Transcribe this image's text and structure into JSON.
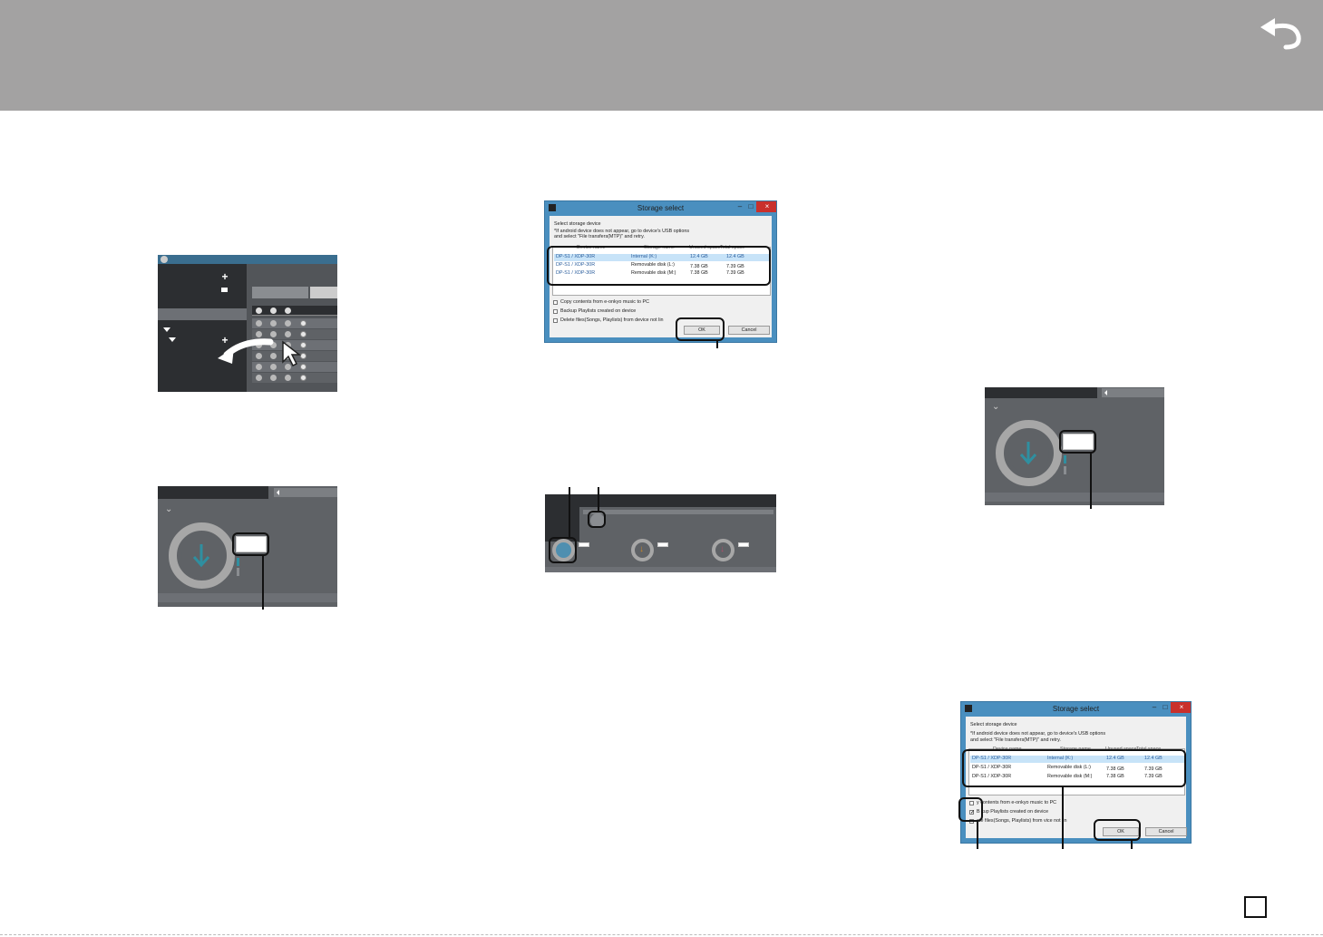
{
  "header": {
    "back_icon": "undo-arrow-icon",
    "color": "#a3a2a2"
  },
  "dialog": {
    "title": "Storage select",
    "minimize": "–",
    "maximize": "□",
    "close": "×",
    "instruction": "Select storage device",
    "note_line1": "*If android device does not appear, go to device's USB options",
    "note_line2": "and select \"File transfers(MTP)\" and retry.",
    "columns": [
      "Device name",
      "Storage name",
      "Unused space",
      "Total space"
    ],
    "rows": [
      [
        "DP-S1 / XDP-30R",
        "Internal (K:)",
        "12.4 GB",
        "12.4 GB"
      ],
      [
        "DP-S1 / XDP-30R",
        "Removable disk (L:)",
        "7.38 GB",
        "7.39 GB"
      ],
      [
        "DP-S1 / XDP-30R",
        "Removable disk (M:)",
        "7.38 GB",
        "7.39 GB"
      ]
    ],
    "options": [
      "Copy contents from e-onkyo music to PC",
      "Backup Playlists created on device",
      "Delete files(Songs, Playlists) from device not lin"
    ],
    "options_right": [
      "y contents from e-onkyo music to PC",
      "B kup Playlists created on device",
      "ete files(Songs, Playlists) from   vice not lin"
    ],
    "ok": "OK",
    "cancel": "Cancel"
  },
  "colors": {
    "dialog_border": "#4a8fbf",
    "app_dark": "#525559",
    "accent_teal": "#2f8fa0",
    "accent_orange": "#c9872a",
    "accent_pink": "#b0506a"
  },
  "app_left": {
    "plus": "+",
    "plus2": "+"
  }
}
